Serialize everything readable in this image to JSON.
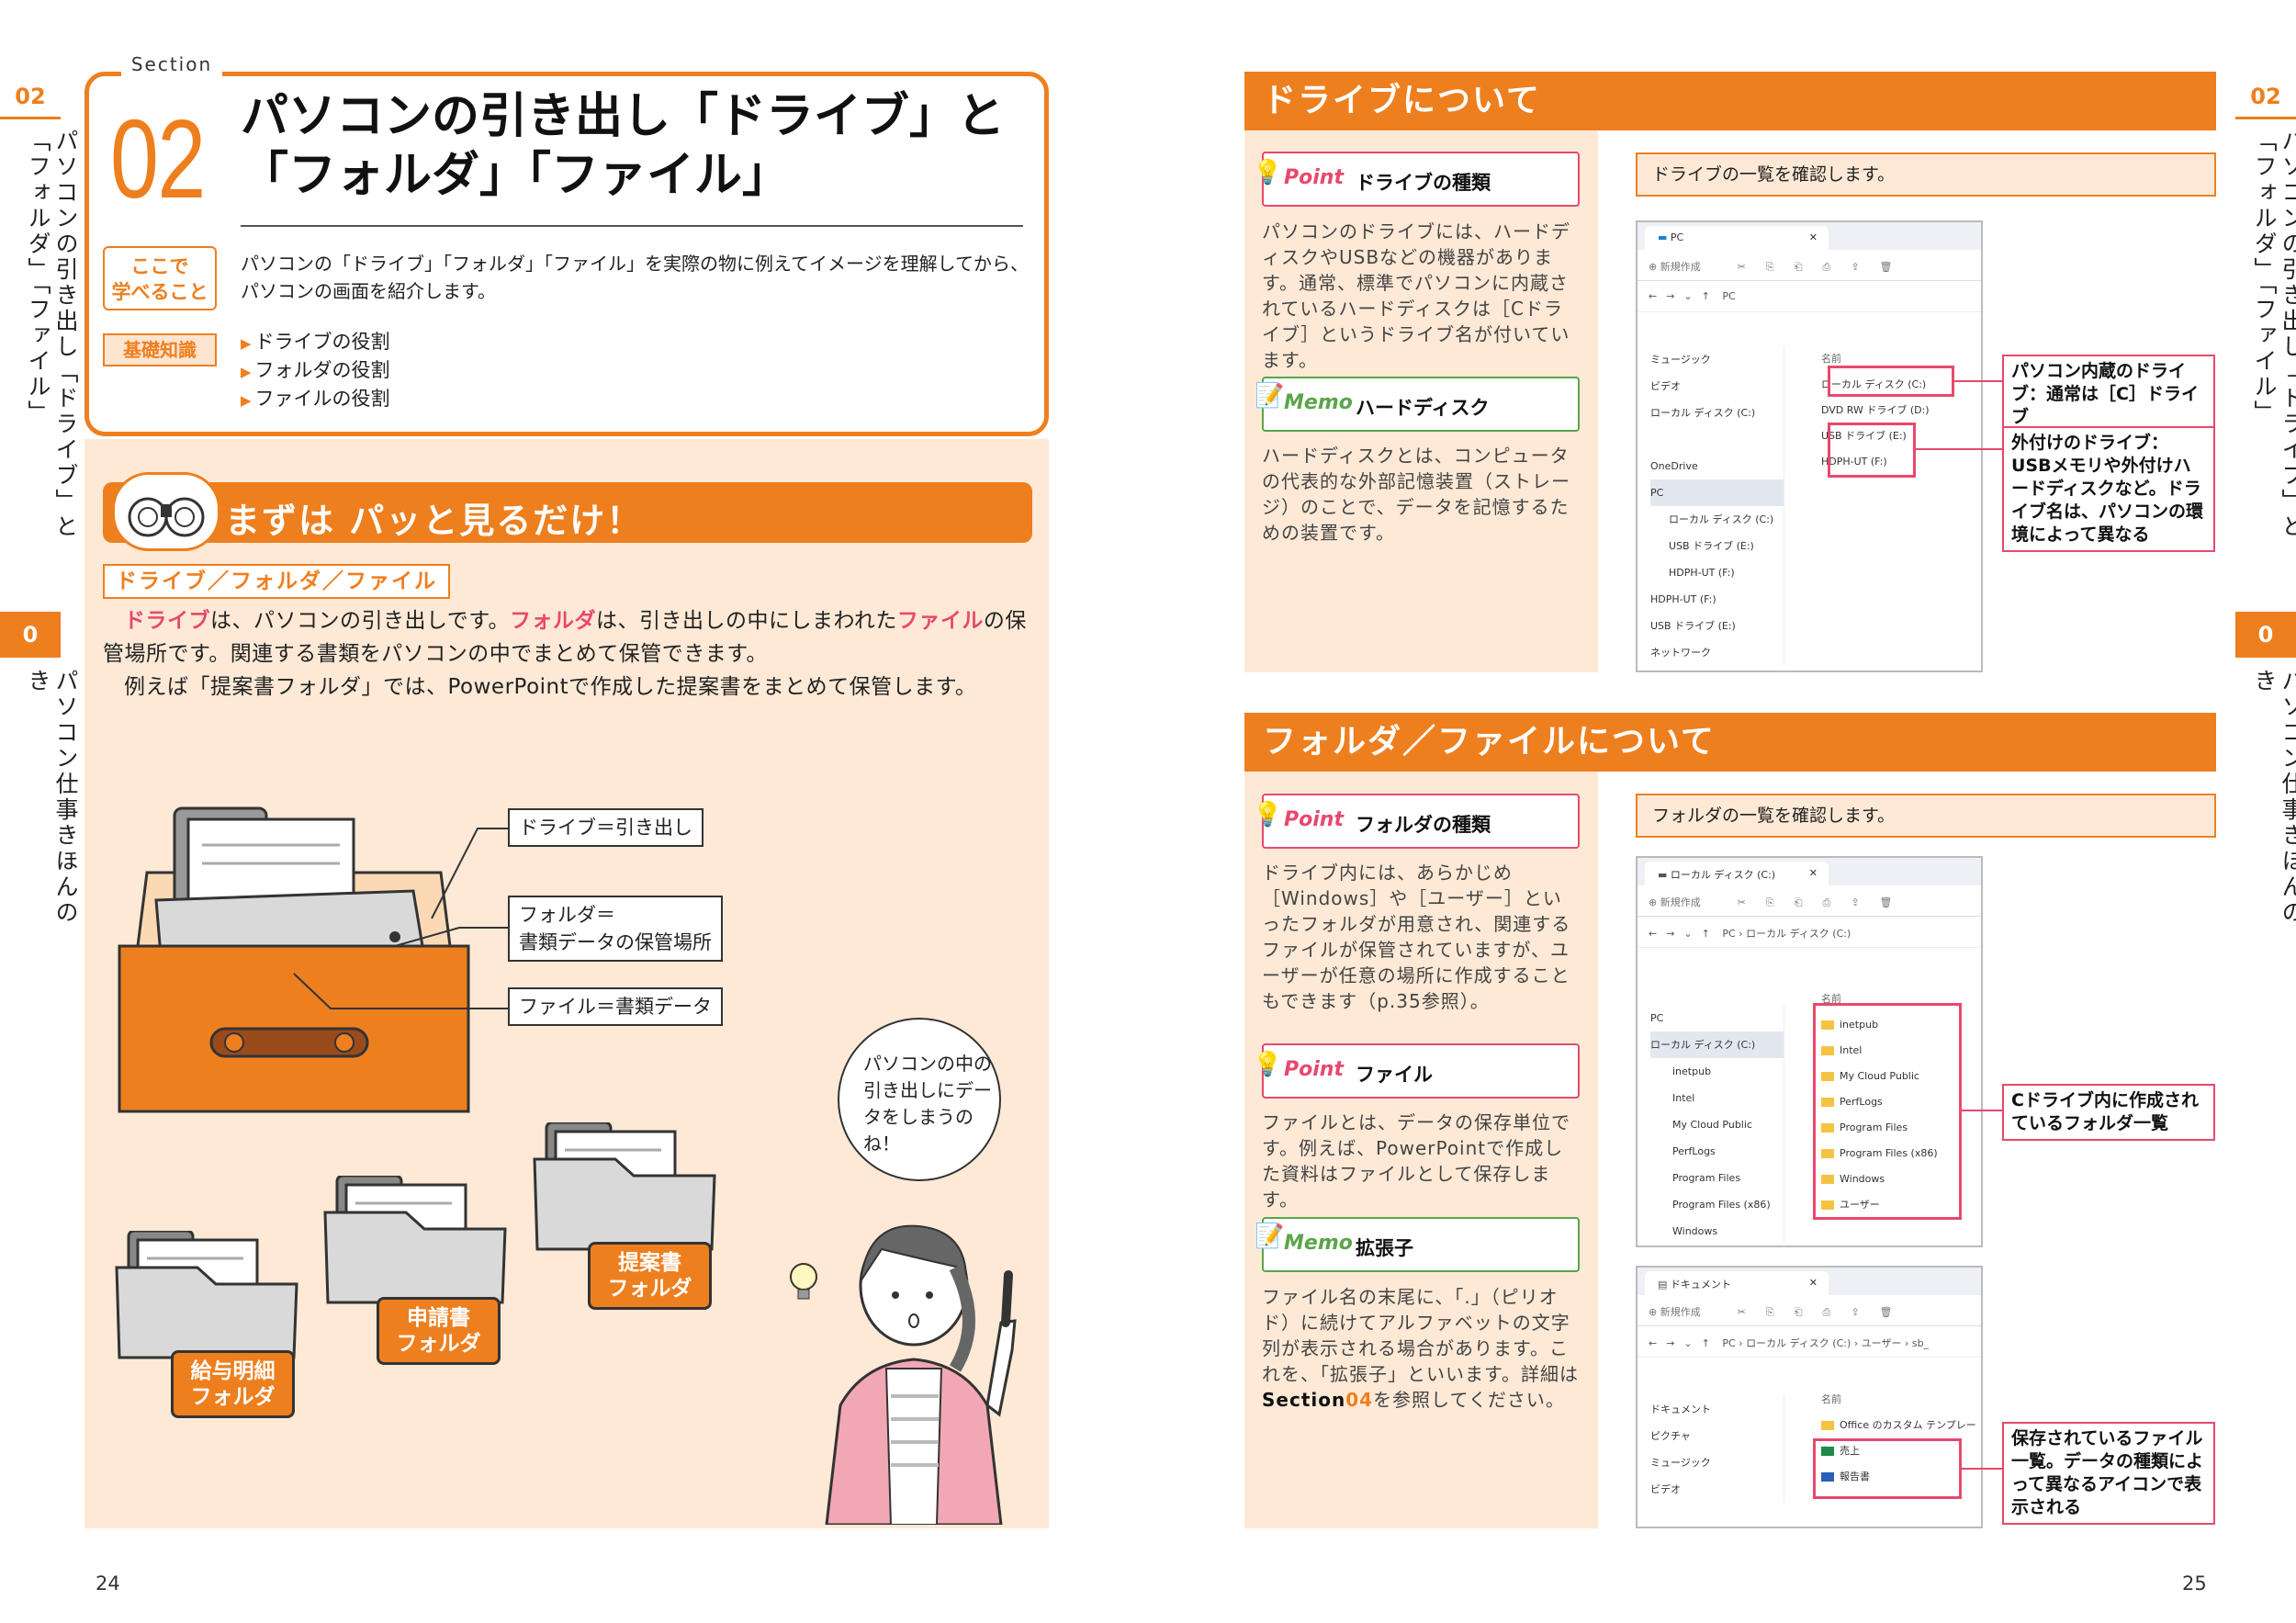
{
  "left_tab": {
    "num_top": "02",
    "vtext_top": "パソコンの引き出し「ドライブ」と「フォルダ」「ファイル」",
    "num_bottom": "0",
    "vtext_bottom": "パソコン仕事きほんのき"
  },
  "right_tab": {
    "num_top": "02",
    "vtext_top": "パソコンの引き出し「ドライブ」と「フォルダ」「ファイル」",
    "num_bottom": "0",
    "vtext_bottom": "パソコン仕事きほんのき"
  },
  "section": {
    "label": "Section",
    "number": "02",
    "title_line1": "パソコンの引き出し「ドライブ」と",
    "title_line2": "「フォルダ」「ファイル」"
  },
  "learn": {
    "badge": "ここで\n学べること",
    "text": "パソコンの「ドライブ」「フォルダ」「ファイル」を実際の物に例えてイメージを理解してから、パソコンの画面を紹介します。",
    "tag": "基礎知識",
    "bullets": [
      "ドライブの役割",
      "フォルダの役割",
      "ファイルの役割"
    ]
  },
  "glance": {
    "banner": "まずは パッと見るだけ！",
    "subhead": "ドライブ／フォルダ／ファイル",
    "p1_a": "ドライブ",
    "p1_b": "は、パソコンの引き出しです。",
    "p1_c": "フォルダ",
    "p1_d": "は、引き出しの中にしまわれた",
    "p1_e": "ファイル",
    "p1_f": "の保管場所です。関連する書類をパソコンの中でまとめて保管できます。",
    "p2": "例えば「提案書フォルダ」では、PowerPointで作成した提案書をまとめて保管します。"
  },
  "illus": {
    "label_drive": "ドライブ＝引き出し",
    "label_folder_1": "フォルダ＝",
    "label_folder_2": "書類データの保管場所",
    "label_file": "ファイル＝書類データ",
    "folder_a": "給与明細\nフォルダ",
    "folder_b": "申請書\nフォルダ",
    "folder_c": "提案書\nフォルダ",
    "bubble": "パソコンの中の引き出しにデータをしまうのね！"
  },
  "page_left": "24",
  "page_right": "25",
  "drive": {
    "banner": "ドライブについて",
    "point_kind": "Point",
    "point_title": "ドライブの種類",
    "point_text": "パソコンのドライブには、ハードディスクやUSBなどの機器があります。通常、標準でパソコンに内蔵されているハードディスクは［Cドライブ］というドライブ名が付いています。",
    "memo_kind": "Memo",
    "memo_title": "ハードディスク",
    "memo_text": "ハードディスクとは、コンピュータの代表的な外部記憶装置（ストレージ）のことで、データを記憶するための装置です。",
    "caption": "ドライブの一覧を確認します。",
    "win": {
      "tab": "PC",
      "toolbar": "新規作成",
      "addr": "PC",
      "col": "名前",
      "nav": [
        "ミュージック",
        "ビデオ",
        "ローカル ディスク (C:)",
        "",
        "OneDrive",
        "PC",
        "ローカル ディスク (C:)",
        "USB ドライブ (E:)",
        "HDPH-UT (F:)",
        "HDPH-UT (F:)",
        "USB ドライブ (E:)",
        "ネットワーク"
      ],
      "list": [
        "ローカル ディスク (C:)",
        "DVD RW ドライブ (D:)",
        "USB ドライブ (E:)",
        "HDPH-UT (F:)"
      ]
    },
    "callout1": "パソコン内蔵のドライブ：通常は［C］ドライブ",
    "callout2": "外付けのドライブ：USBメモリや外付けハードディスクなど。ドライブ名は、パソコンの環境によって異なる"
  },
  "folder": {
    "banner": "フォルダ／ファイルについて",
    "point1_kind": "Point",
    "point1_title": "フォルダの種類",
    "point1_text": "ドライブ内には、あらかじめ［Windows］や［ユーザー］といったフォルダが用意され、関連するファイルが保管されていますが、ユーザーが任意の場所に作成することもできます（p.35参照）。",
    "point2_kind": "Point",
    "point2_title": "ファイル",
    "point2_text": "ファイルとは、データの保存単位です。例えば、PowerPointで作成した資料はファイルとして保存します。",
    "memo_kind": "Memo",
    "memo_title": "拡張子",
    "memo_text_a": "ファイル名の末尾に、「.」（ピリオド）に続けてアルファベットの文字列が表示される場合があります。これを、「拡張子」といいます。詳細は",
    "memo_text_b": "Section",
    "memo_text_c": "04",
    "memo_text_d": "を参照してください。",
    "caption": "フォルダの一覧を確認します。",
    "win1": {
      "tab": "ローカル ディスク (C:)",
      "toolbar": "新規作成",
      "addr": "PC  ›  ローカル ディスク (C:)",
      "col": "名前",
      "nav": [
        "PC",
        "ローカル ディスク (C:)",
        "inetpub",
        "Intel",
        "My Cloud Public",
        "PerfLogs",
        "Program Files",
        "Program Files (x86)",
        "Windows"
      ],
      "list": [
        "inetpub",
        "Intel",
        "My Cloud Public",
        "PerfLogs",
        "Program Files",
        "Program Files (x86)",
        "Windows",
        "ユーザー"
      ]
    },
    "callout1": "Cドライブ内に作成されているフォルダ一覧",
    "win2": {
      "tab": "ドキュメント",
      "toolbar": "新規作成",
      "addr": "PC  ›  ローカル ディスク (C:)  ›  ユーザー  ›  sb_",
      "col": "名前",
      "nav": [
        "ドキュメント",
        "ピクチャ",
        "ミュージック",
        "ビデオ"
      ],
      "list": [
        "Office のカスタム テンプレート",
        "売上",
        "報告書"
      ]
    },
    "callout2": "保存されているファイル一覧。データの種類によって異なるアイコンで表示される"
  }
}
